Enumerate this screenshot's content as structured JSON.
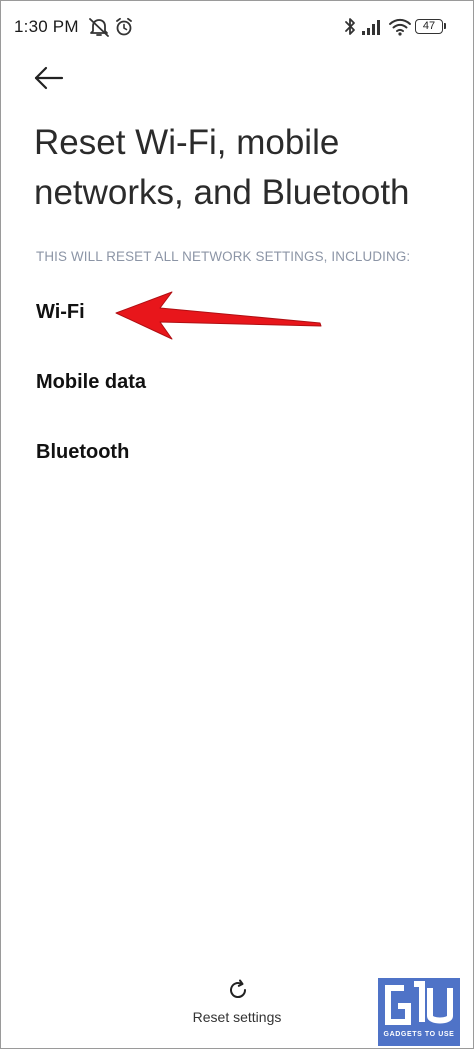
{
  "status_bar": {
    "time": "1:30 PM",
    "battery_level": "47",
    "icons": [
      "muted-bell-icon",
      "alarm-icon",
      "bluetooth-icon",
      "cellular-signal-icon",
      "wifi-icon",
      "battery-icon"
    ]
  },
  "header": {
    "back_icon": "back-arrow-icon",
    "title": "Reset Wi-Fi, mobile networks, and Bluetooth"
  },
  "section": {
    "caption": "THIS WILL RESET ALL NETWORK SETTINGS, INCLUDING:",
    "items": [
      {
        "label": "Wi-Fi"
      },
      {
        "label": "Mobile data"
      },
      {
        "label": "Bluetooth"
      }
    ]
  },
  "annotation": {
    "type": "arrow",
    "color": "#e8161b",
    "points_to": "Wi-Fi"
  },
  "footer": {
    "reset_icon": "refresh-icon",
    "reset_label": "Reset settings"
  },
  "watermark": {
    "text": "GADGETS TO USE",
    "color": "#4f73c7"
  },
  "colors": {
    "background": "#ffffff",
    "caption": "#8c95a6",
    "text": "#111111",
    "arrow": "#e8161b"
  }
}
